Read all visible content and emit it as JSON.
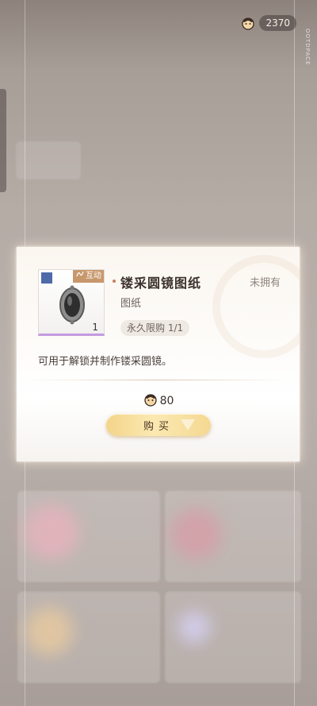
{
  "currency": {
    "amount": "2370",
    "icon": "coin-icon"
  },
  "side_text": "OOTDPACE",
  "item": {
    "name": "镂采圆镜图纸",
    "type": "图纸",
    "tag": "互动",
    "count": "1",
    "own_status": "未拥有",
    "limit": "永久限购 1/1",
    "description": "可用于解锁并制作镂采圆镜。"
  },
  "purchase": {
    "price": "80",
    "button_label": "购买"
  }
}
